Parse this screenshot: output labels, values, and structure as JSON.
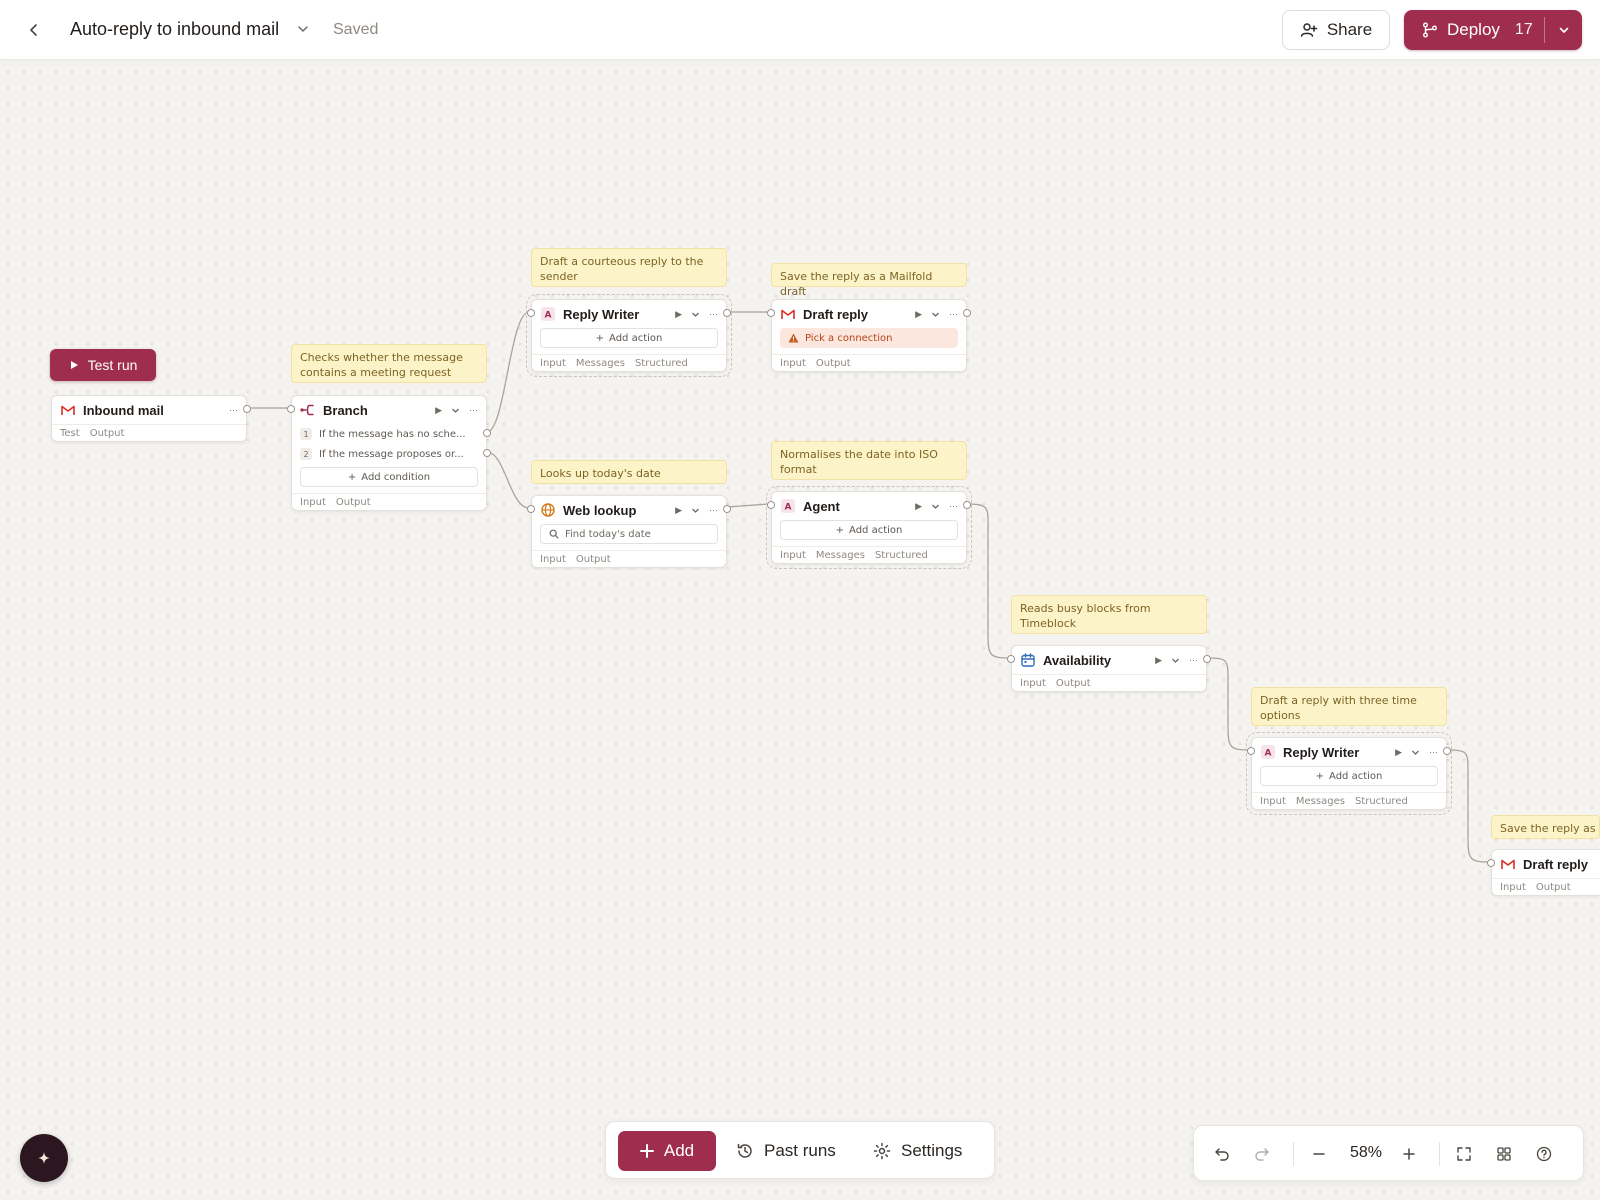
{
  "header": {
    "title": "Auto-reply to inbound mail",
    "status": "Saved",
    "share_label": "Share",
    "deploy_label": "Deploy",
    "deploy_count": "17"
  },
  "canvas": {
    "test_run_label": "Test run",
    "notes": {
      "reply_writer_1": "Draft a courteous reply to the sender",
      "draft_reply_1": "Save the reply as a Mailfold draft",
      "branch": "Checks whether the message contains a meeting request",
      "web_lookup": "Looks up today's date",
      "agent": "Normalises the date into ISO format",
      "availability": "Reads busy blocks from Timeblock",
      "reply_writer_2": "Draft a reply with three time options",
      "draft_reply_2": "Save the reply as a"
    },
    "nodes": {
      "inbound_mail": {
        "title": "Inbound mail",
        "tabs": [
          "Test",
          "Output"
        ]
      },
      "branch": {
        "title": "Branch",
        "conditions": [
          {
            "num": "1",
            "text": "If the message has no sche..."
          },
          {
            "num": "2",
            "text": "If the message proposes or..."
          }
        ],
        "add_label": "Add condition",
        "tabs": [
          "Input",
          "Output"
        ]
      },
      "reply_writer_1": {
        "title": "Reply Writer",
        "add_label": "Add action",
        "tabs": [
          "Input",
          "Messages",
          "Structured"
        ]
      },
      "draft_reply_1": {
        "title": "Draft reply",
        "warning": "Pick a connection",
        "tabs": [
          "Input",
          "Output"
        ]
      },
      "web_lookup": {
        "title": "Web lookup",
        "query": "Find today's date",
        "tabs": [
          "Input",
          "Output"
        ]
      },
      "agent": {
        "title": "Agent",
        "add_label": "Add action",
        "tabs": [
          "Input",
          "Messages",
          "Structured"
        ]
      },
      "availability": {
        "title": "Availability",
        "tabs": [
          "Input",
          "Output"
        ]
      },
      "reply_writer_2": {
        "title": "Reply Writer",
        "add_label": "Add action",
        "tabs": [
          "Input",
          "Messages",
          "Structured"
        ]
      },
      "draft_reply_2": {
        "title": "Draft reply",
        "tabs": [
          "Input",
          "Output"
        ]
      }
    }
  },
  "toolbar": {
    "add_label": "Add",
    "past_runs_label": "Past runs",
    "settings_label": "Settings"
  },
  "zoom": {
    "level": "58%"
  },
  "icons": {
    "back": "chevron-left-icon",
    "share": "user-plus-icon",
    "deploy": "branch-icon",
    "mail": "gmail-icon",
    "agent": "agent-a-icon",
    "web": "globe-icon",
    "calendar": "calendar-icon",
    "ai": "sparkle-icon"
  },
  "colors": {
    "accent": "#9f2e4e",
    "note_bg": "#fdf3c9",
    "warning": "#b74317",
    "canvas_bg": "#f5f3f0"
  }
}
